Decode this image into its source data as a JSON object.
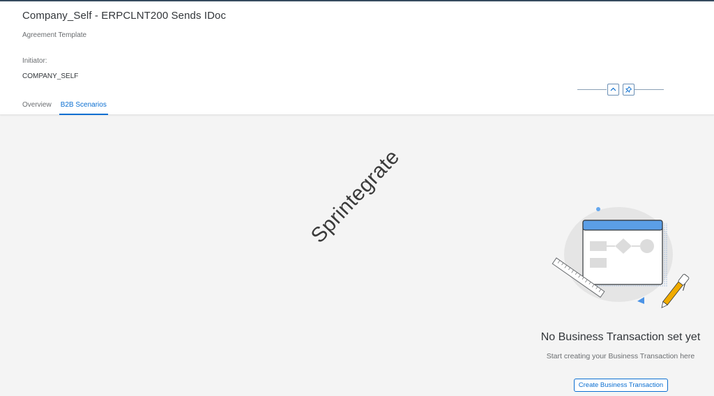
{
  "header": {
    "title": "Company_Self - ERPCLNT200 Sends IDoc",
    "subtitle": "Agreement Template",
    "initiator_label": "Initiator:",
    "initiator_value": "COMPANY_SELF"
  },
  "tabs": [
    {
      "label": "Overview",
      "active": false
    },
    {
      "label": "B2B Scenarios",
      "active": true
    }
  ],
  "header_controls": {
    "collapse_icon": "chevron-up-icon",
    "pin_icon": "pin-icon"
  },
  "watermark": "Sprintegrate",
  "empty_state": {
    "title": "No Business Transaction set yet",
    "description": "Start creating your Business Transaction here",
    "button_label": "Create Business Transaction",
    "illustration": "empty-business-transaction-illustration"
  },
  "colors": {
    "accent": "#0a6ed1",
    "shell": "#354a5f",
    "background": "#f4f4f4"
  }
}
